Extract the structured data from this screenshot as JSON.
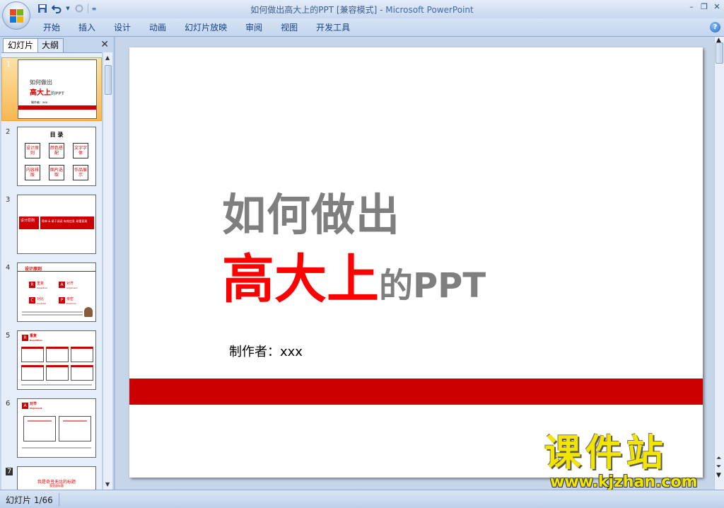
{
  "window": {
    "title": "如何做出高大上的PPT [兼容模式]",
    "separator": " - ",
    "app_name": "Microsoft PowerPoint",
    "controls": [
      "–",
      "❐",
      "✕"
    ]
  },
  "qat": {
    "icons": [
      "save-icon",
      "undo-icon",
      "redo-icon",
      "customize-icon"
    ]
  },
  "menu": {
    "tabs": [
      "开始",
      "插入",
      "设计",
      "动画",
      "幻灯片放映",
      "审阅",
      "视图",
      "开发工具"
    ],
    "help": "?"
  },
  "left_pane": {
    "tab_slides": "幻灯片",
    "tab_outline": "大纲",
    "close": "✕",
    "thumbnails": [
      {
        "num": "1",
        "line1": "如何做出",
        "line2a": "高大上",
        "line2b": "的PPT",
        "author": "制作者：xxx"
      },
      {
        "num": "2",
        "title": "目  录",
        "items": [
          "设计原则",
          "颜色搭配",
          "文字字体",
          "内容排版",
          "图片选取",
          "作品展示"
        ]
      },
      {
        "num": "3",
        "label": "设计原则",
        "text": "简单 & 易于阅读 有效信息 易懂直观"
      },
      {
        "num": "4",
        "title": "设计原则",
        "items": [
          {
            "letter": "R",
            "cn": "重复",
            "en": "Repetition"
          },
          {
            "letter": "A",
            "cn": "对齐",
            "en": "Alignment"
          },
          {
            "letter": "C",
            "cn": "对比",
            "en": "Contrast"
          },
          {
            "letter": "P",
            "cn": "亲密",
            "en": "Proximity"
          }
        ]
      },
      {
        "num": "5",
        "letter": "R",
        "title": "重复",
        "sub": "Repetition"
      },
      {
        "num": "6",
        "letter": "A",
        "title": "对齐",
        "sub": "Alignment"
      },
      {
        "num": "7",
        "title": "我是奇丑无比的标题",
        "sub": "我是副标题"
      }
    ]
  },
  "slide": {
    "title_line1": "如何做出",
    "title_red": "高大上",
    "title_gray": "的PPT",
    "author": "制作者：xxx",
    "band_color": "#cc0000"
  },
  "watermark": {
    "cn": "课件站",
    "url": "www.kjzhan.com"
  },
  "status": {
    "slide_indicator": "幻灯片 1/66"
  },
  "colors": {
    "accent_red": "#ff0000",
    "title_gray": "#7f7f7f",
    "watermark_yellow": "#f2e600"
  }
}
